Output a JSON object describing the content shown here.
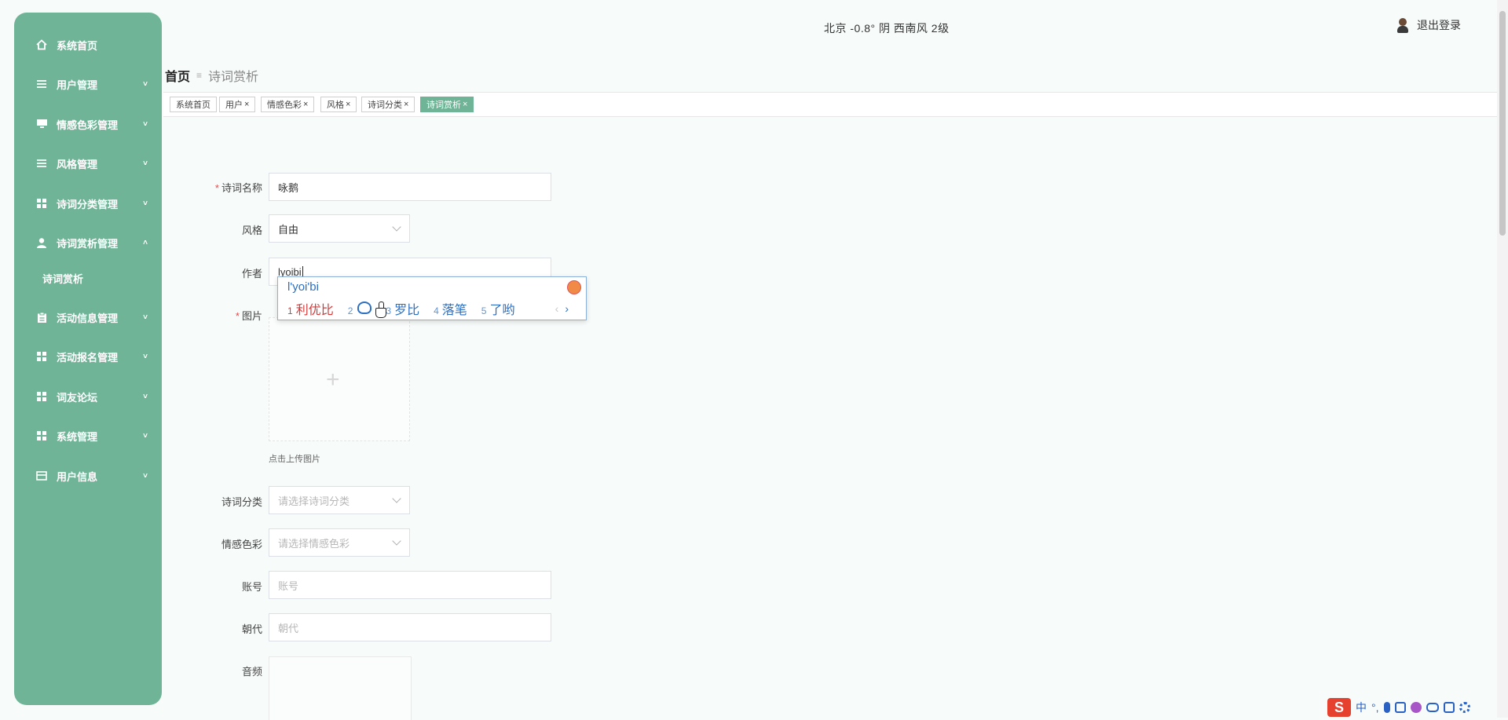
{
  "sidebar": {
    "items": [
      {
        "label": "系统首页",
        "icon": "home-icon",
        "has_caret": false
      },
      {
        "label": "用户管理",
        "icon": "list-icon",
        "has_caret": true,
        "caret": "˅"
      },
      {
        "label": "情感色彩管理",
        "icon": "monitor-icon",
        "has_caret": true,
        "caret": "˅"
      },
      {
        "label": "风格管理",
        "icon": "list-icon",
        "has_caret": true,
        "caret": "˅"
      },
      {
        "label": "诗词分类管理",
        "icon": "grid-icon",
        "has_caret": true,
        "caret": "˅"
      },
      {
        "label": "诗词赏析管理",
        "icon": "user-icon",
        "has_caret": true,
        "caret": "˄"
      },
      {
        "label": "活动信息管理",
        "icon": "clipboard-icon",
        "has_caret": true,
        "caret": "˅"
      },
      {
        "label": "活动报名管理",
        "icon": "grid-icon",
        "has_caret": true,
        "caret": "˅"
      },
      {
        "label": "词友论坛",
        "icon": "grid-icon",
        "has_caret": true,
        "caret": "˅"
      },
      {
        "label": "系统管理",
        "icon": "grid-icon",
        "has_caret": true,
        "caret": "˅"
      },
      {
        "label": "用户信息",
        "icon": "card-icon",
        "has_caret": true,
        "caret": "˅"
      }
    ],
    "submenu_label": "诗词赏析"
  },
  "header": {
    "weather": "北京  -0.8°  阴  西南风  2级",
    "logout": "退出登录"
  },
  "breadcrumb": {
    "home": "首页",
    "sep": "≡",
    "current": "诗词赏析"
  },
  "tags": [
    {
      "label": "系统首页",
      "closable": false,
      "active": false
    },
    {
      "label": "用户",
      "closable": true,
      "active": false
    },
    {
      "label": "情感色彩",
      "closable": true,
      "active": false
    },
    {
      "label": "风格",
      "closable": true,
      "active": false
    },
    {
      "label": "诗词分类",
      "closable": true,
      "active": false
    },
    {
      "label": "诗词赏析",
      "closable": true,
      "active": true
    }
  ],
  "form": {
    "poem_name_label": "诗词名称",
    "poem_name_value": "咏鹅",
    "style_label": "风格",
    "style_value": "自由",
    "author_label": "作者",
    "author_value": "lyoibi",
    "image_label": "图片",
    "upload_hint": "点击上传图片",
    "category_label": "诗词分类",
    "category_placeholder": "请选择诗词分类",
    "emotion_label": "情感色彩",
    "emotion_placeholder": "请选择情感色彩",
    "account_label": "账号",
    "account_placeholder": "账号",
    "dynasty_label": "朝代",
    "dynasty_placeholder": "朝代",
    "audio_label": "音频",
    "required_mark": "*"
  },
  "ime": {
    "input": "l'yoi'bi",
    "candidates": [
      {
        "n": "1",
        "text": "利优比"
      },
      {
        "n": "2",
        "text": ""
      },
      {
        "n": "3",
        "text": "罗比"
      },
      {
        "n": "4",
        "text": "落笔"
      },
      {
        "n": "5",
        "text": "了哟"
      }
    ],
    "prev": "‹",
    "next": "›"
  },
  "tray": {
    "logo": "S",
    "lang": "中",
    "punct": "°,"
  },
  "colors": {
    "sidebar": "#6fb497",
    "accent": "#6fb497",
    "required": "#e24c4c",
    "ime_text": "#2d6fc0"
  }
}
